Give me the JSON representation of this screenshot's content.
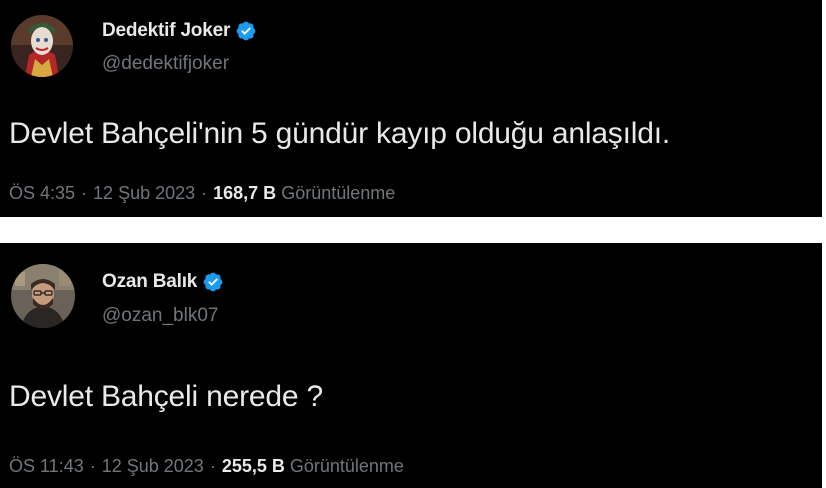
{
  "tweets": [
    {
      "display_name": "Dedektif Joker",
      "handle": "@dedektifjoker",
      "verified": true,
      "text": "Devlet Bahçeli'nin 5 gündür kayıp olduğu anlaşıldı.",
      "time": "ÖS 4:35",
      "date": "12 Şub 2023",
      "views_count": "168,7 B",
      "views_label": "Görüntülenme"
    },
    {
      "display_name": "Ozan Balık",
      "handle": "@ozan_blk07",
      "verified": true,
      "text": "Devlet Bahçeli nerede ?",
      "time": "ÖS 11:43",
      "date": "12 Şub 2023",
      "views_count": "255,5 B",
      "views_label": "Görüntülenme"
    }
  ],
  "separator": "·",
  "colors": {
    "background": "#000000",
    "primary_text": "#e7e9ea",
    "secondary_text": "#71767b",
    "verified_badge": "#1d9bf0"
  },
  "icons": {
    "verified": "verified-badge-icon"
  }
}
